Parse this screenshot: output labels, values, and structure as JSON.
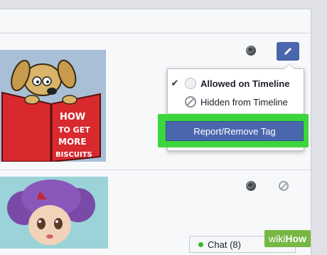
{
  "dropdown": {
    "items": [
      {
        "label": "Allowed on Timeline",
        "checked": true
      },
      {
        "label": "Hidden from Timeline",
        "checked": false
      }
    ]
  },
  "report_button": {
    "label": "Report/Remove Tag"
  },
  "thumbnail_1": {
    "book_text": [
      "HOW",
      "TO GET",
      "MORE",
      "BISCUITS"
    ]
  },
  "chat": {
    "label": "Chat (8)"
  },
  "watermark": {
    "part1": "wiki",
    "part2": "How"
  },
  "icons": {
    "audience_1": "globe-icon",
    "edit": "pencil-icon",
    "audience_2": "globe-icon",
    "hide": "blocked-icon"
  },
  "colors": {
    "accent": "#4a67ad",
    "highlight": "#3cd63c",
    "online": "#42b72a"
  }
}
